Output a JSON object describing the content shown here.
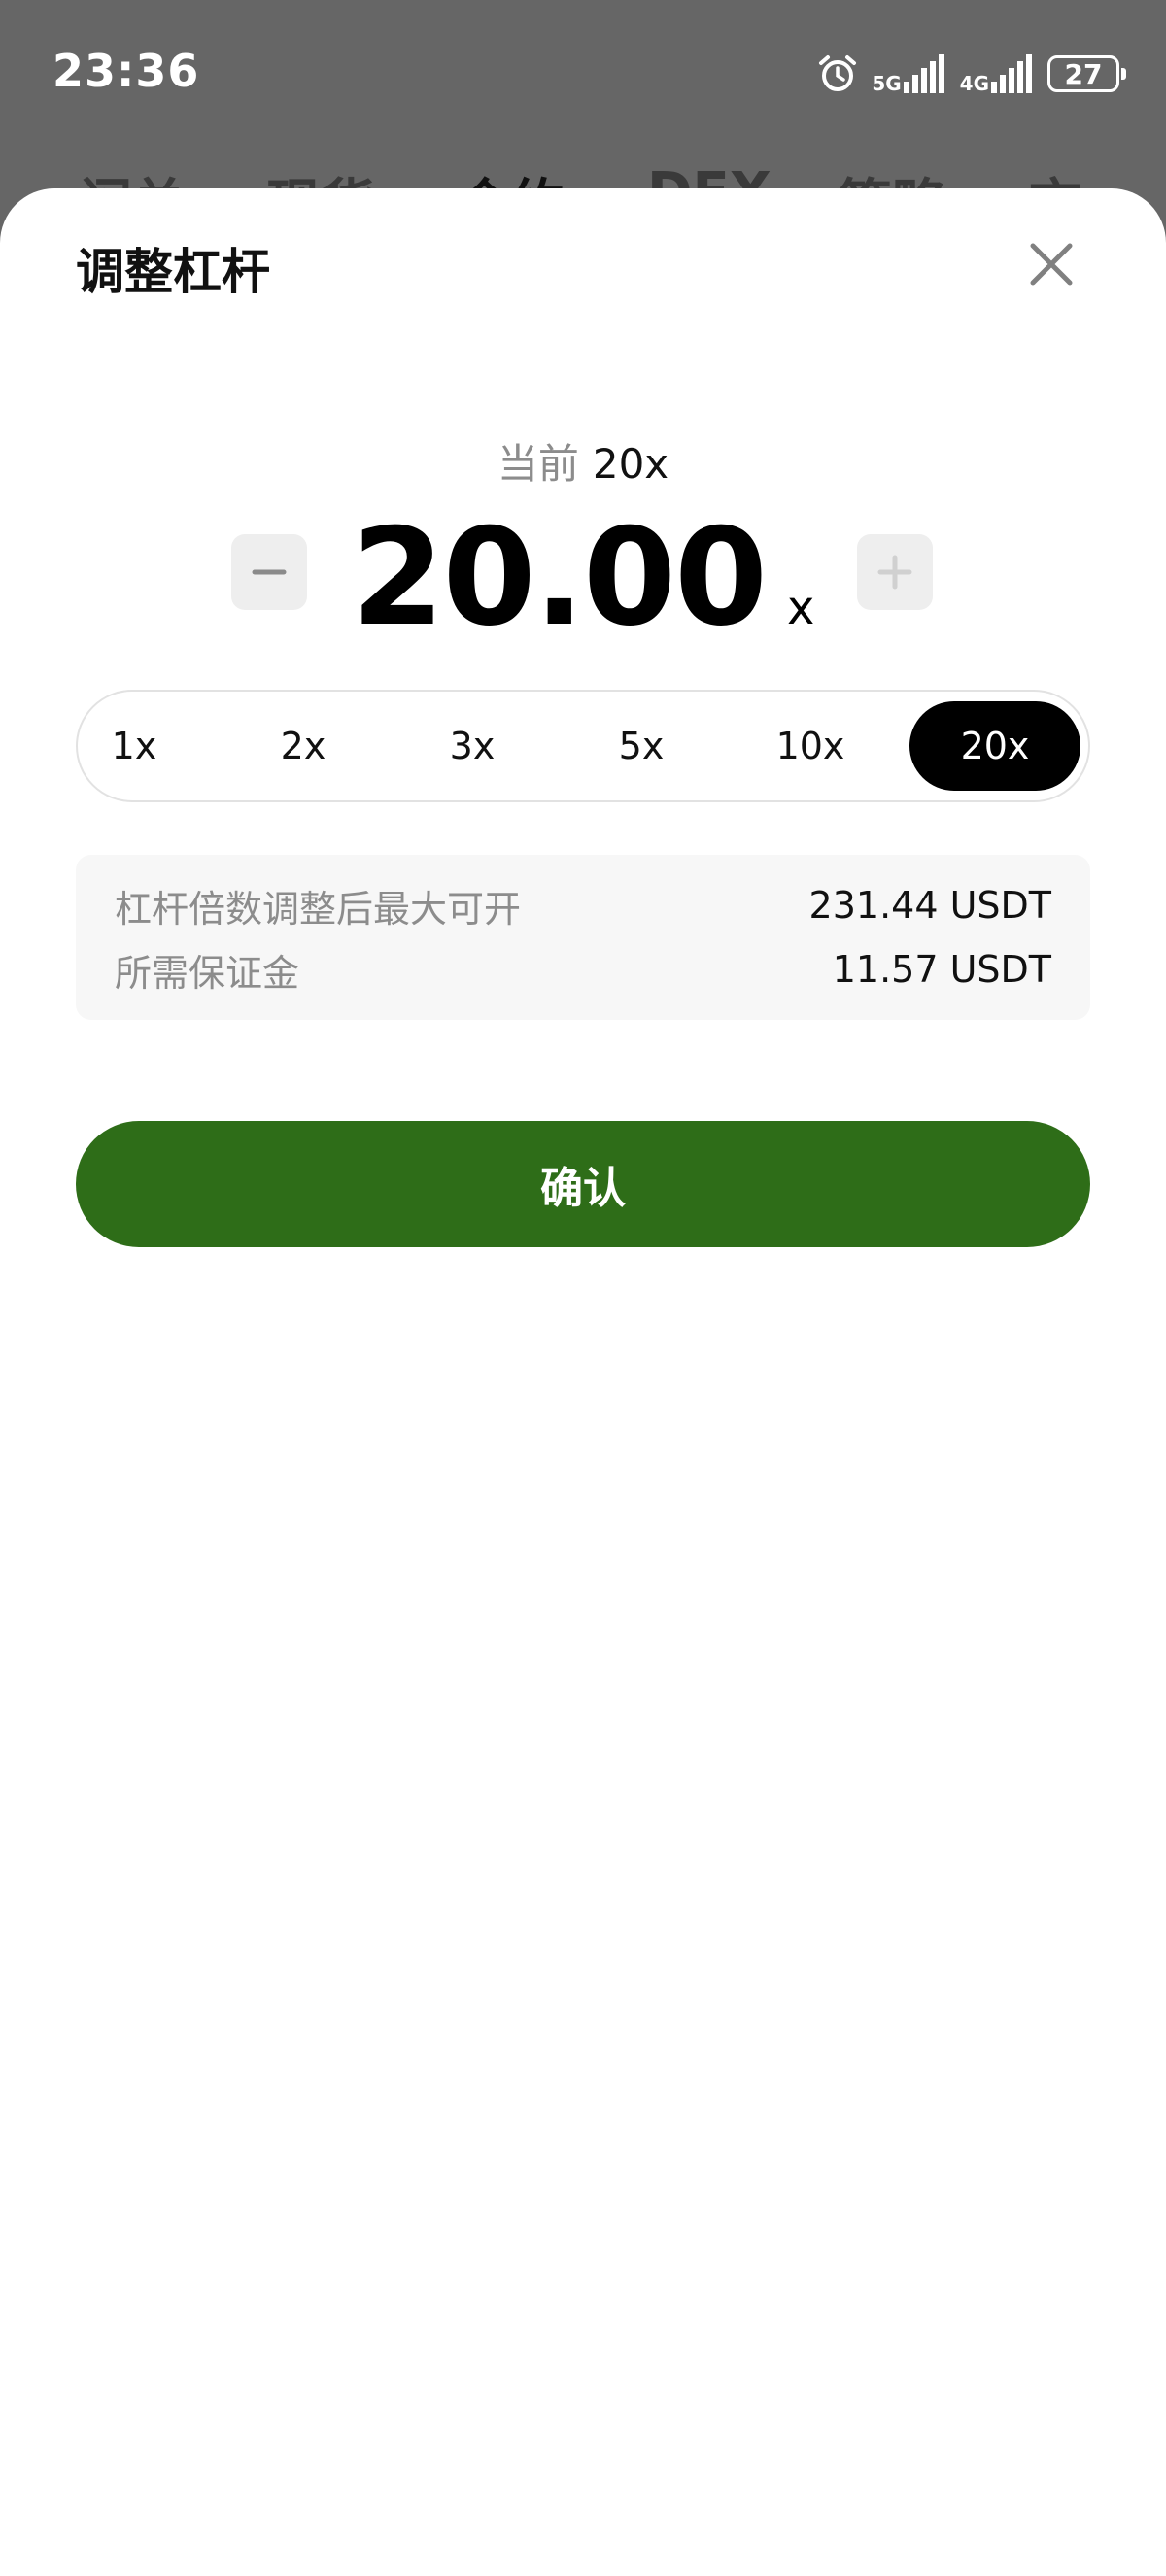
{
  "status_bar": {
    "time": "23:36",
    "network_1": "5G",
    "network_2": "4G",
    "battery": "27"
  },
  "background_nav": {
    "items": [
      "闪兑",
      "现货",
      "合约",
      "DEX",
      "策略",
      "交"
    ]
  },
  "sheet": {
    "title": "调整杠杆",
    "current_label": "当前",
    "current_value": "20x",
    "leverage_value": "20.00",
    "leverage_unit": "x",
    "presets": [
      {
        "label": "1x",
        "active": false
      },
      {
        "label": "2x",
        "active": false
      },
      {
        "label": "3x",
        "active": false
      },
      {
        "label": "5x",
        "active": false
      },
      {
        "label": "10x",
        "active": false
      },
      {
        "label": "20x",
        "active": true
      }
    ],
    "info": {
      "max_open_label": "杠杆倍数调整后最大可开",
      "max_open_value": "231.44 USDT",
      "margin_label": "所需保证金",
      "margin_value": "11.57 USDT"
    },
    "confirm_label": "确认"
  },
  "colors": {
    "confirm": "#2e6d18",
    "active_preset": "#000000",
    "overlay": "#666666"
  },
  "icons": {
    "close": "close-icon",
    "minus": "minus-icon",
    "plus": "plus-icon",
    "alarm": "alarm-icon",
    "signal": "signal-icon",
    "battery": "battery-icon"
  }
}
